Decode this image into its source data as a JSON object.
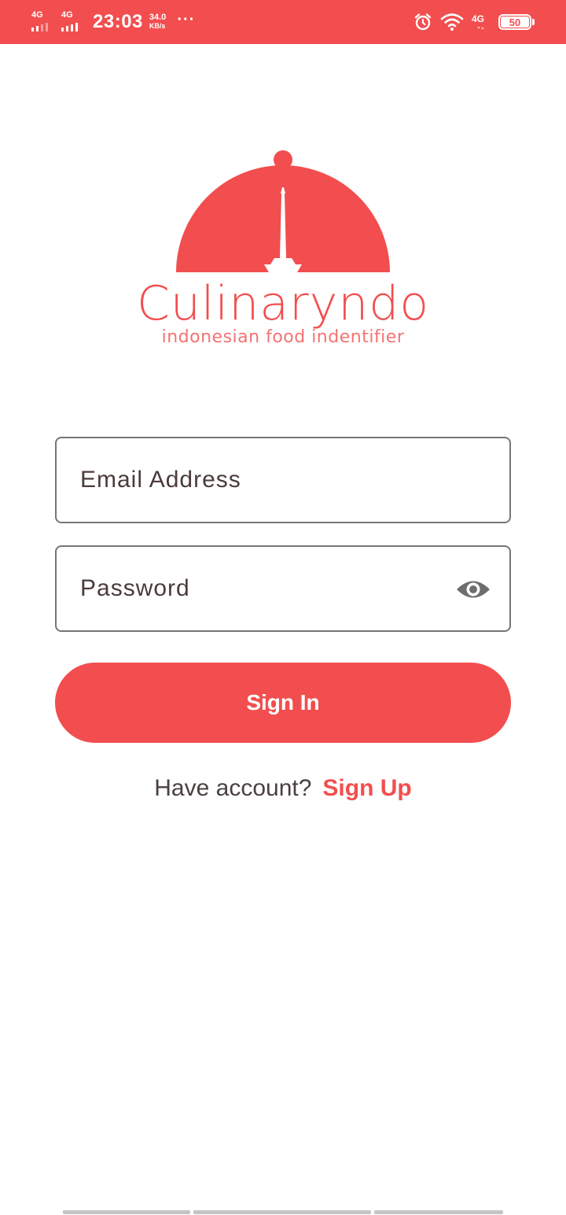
{
  "status_bar": {
    "network_1": "4G",
    "network_2": "4G",
    "time": "23:03",
    "speed_value": "34.0",
    "speed_unit": "KB/s",
    "more": "···",
    "network_right": "4G",
    "battery": "50",
    "icons": [
      "alarm-icon",
      "wifi-icon",
      "signal-icon",
      "battery-icon"
    ]
  },
  "logo": {
    "name": "Culinaryndo",
    "tagline": "indonesian food indentifier"
  },
  "form": {
    "email_placeholder": "Email Address",
    "email_value": "",
    "password_placeholder": "Password",
    "password_value": "",
    "signin_label": "Sign In",
    "have_account": "Have account?",
    "signup_label": "Sign Up"
  },
  "colors": {
    "brand": "#f24e4f",
    "text": "#4c3b3b",
    "border": "#7a7474",
    "icon": "#6e6e6e"
  }
}
